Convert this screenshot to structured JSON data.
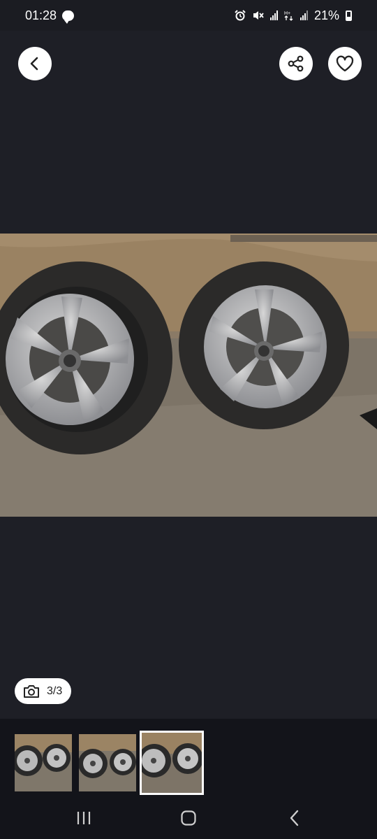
{
  "status_bar": {
    "time": "01:28",
    "battery": "21%"
  },
  "viewer": {
    "counter": "3/3",
    "current_index": 3,
    "total": 3
  },
  "thumbnails": [
    {
      "name": "thumbnail-1",
      "active": false
    },
    {
      "name": "thumbnail-2",
      "active": false
    },
    {
      "name": "thumbnail-3",
      "active": true
    }
  ],
  "icons": {
    "back": "chevron-left-icon",
    "share": "share-icon",
    "favorite": "heart-icon",
    "camera": "camera-icon"
  }
}
